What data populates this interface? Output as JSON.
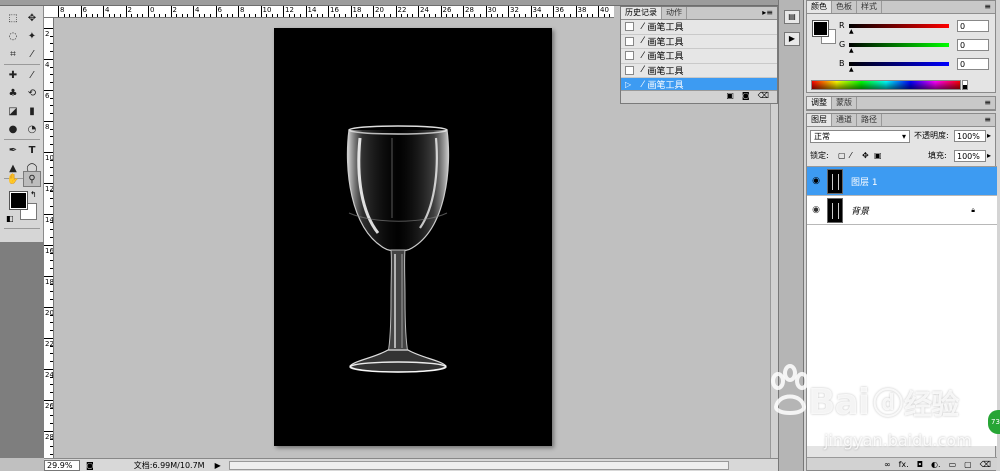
{
  "tools": {
    "icons": [
      "marquee-icon",
      "move-icon",
      "lasso-icon",
      "magic-wand-icon",
      "crop-icon",
      "eyedropper-icon",
      "healing-icon",
      "brush-icon",
      "clone-stamp-icon",
      "history-brush-icon",
      "eraser-icon",
      "gradient-icon",
      "blur-icon",
      "dodge-icon",
      "pen-icon",
      "type-icon",
      "path-select-icon",
      "shape-icon",
      "hand-icon",
      "zoom-icon"
    ]
  },
  "ruler": {
    "top": [
      "8",
      "6",
      "4",
      "2",
      "0",
      "2",
      "4",
      "6",
      "8",
      "10",
      "12",
      "14",
      "16",
      "18",
      "20",
      "22",
      "24",
      "26",
      "28",
      "30",
      "32",
      "34",
      "36",
      "38",
      "40"
    ],
    "left": [
      "2",
      "4",
      "6",
      "8",
      "10",
      "12",
      "14",
      "16",
      "18",
      "20",
      "22",
      "24",
      "26",
      "28"
    ]
  },
  "history": {
    "tabs": [
      "历史记录",
      "动作"
    ],
    "menu": "▸≡",
    "rows": [
      {
        "label": "画笔工具",
        "selected": false
      },
      {
        "label": "画笔工具",
        "selected": false
      },
      {
        "label": "画笔工具",
        "selected": false
      },
      {
        "label": "画笔工具",
        "selected": false
      },
      {
        "label": "画笔工具",
        "selected": true
      }
    ],
    "foot": [
      "▣",
      "◙",
      "⌫"
    ]
  },
  "color": {
    "tabs": [
      "颜色",
      "色板",
      "样式"
    ],
    "r": {
      "label": "R",
      "value": "0"
    },
    "g": {
      "label": "G",
      "value": "0"
    },
    "b": {
      "label": "B",
      "value": "0"
    }
  },
  "adjust": {
    "tabs": [
      "调整",
      "蒙版"
    ]
  },
  "layers": {
    "tabs": [
      "图层",
      "通道",
      "路径"
    ],
    "blend_mode": "正常",
    "opacity_label": "不透明度:",
    "opacity_value": "100%",
    "lock_label": "锁定:",
    "fill_label": "填充:",
    "fill_value": "100%",
    "items": [
      {
        "name": "图层 1",
        "selected": true
      },
      {
        "name": "背景",
        "selected": false
      }
    ],
    "foot": [
      "∞",
      "fx.",
      "◘",
      "◐.",
      "▭",
      "▢",
      "⌫"
    ]
  },
  "status": {
    "zoom": "29.9%",
    "doc_info": "文档:6.99M/10.7M",
    "arrow": "▶"
  },
  "watermark": {
    "brand": "Bai",
    "brand2": "经验",
    "url": "jingyan.baidu.com"
  },
  "badge": "73"
}
